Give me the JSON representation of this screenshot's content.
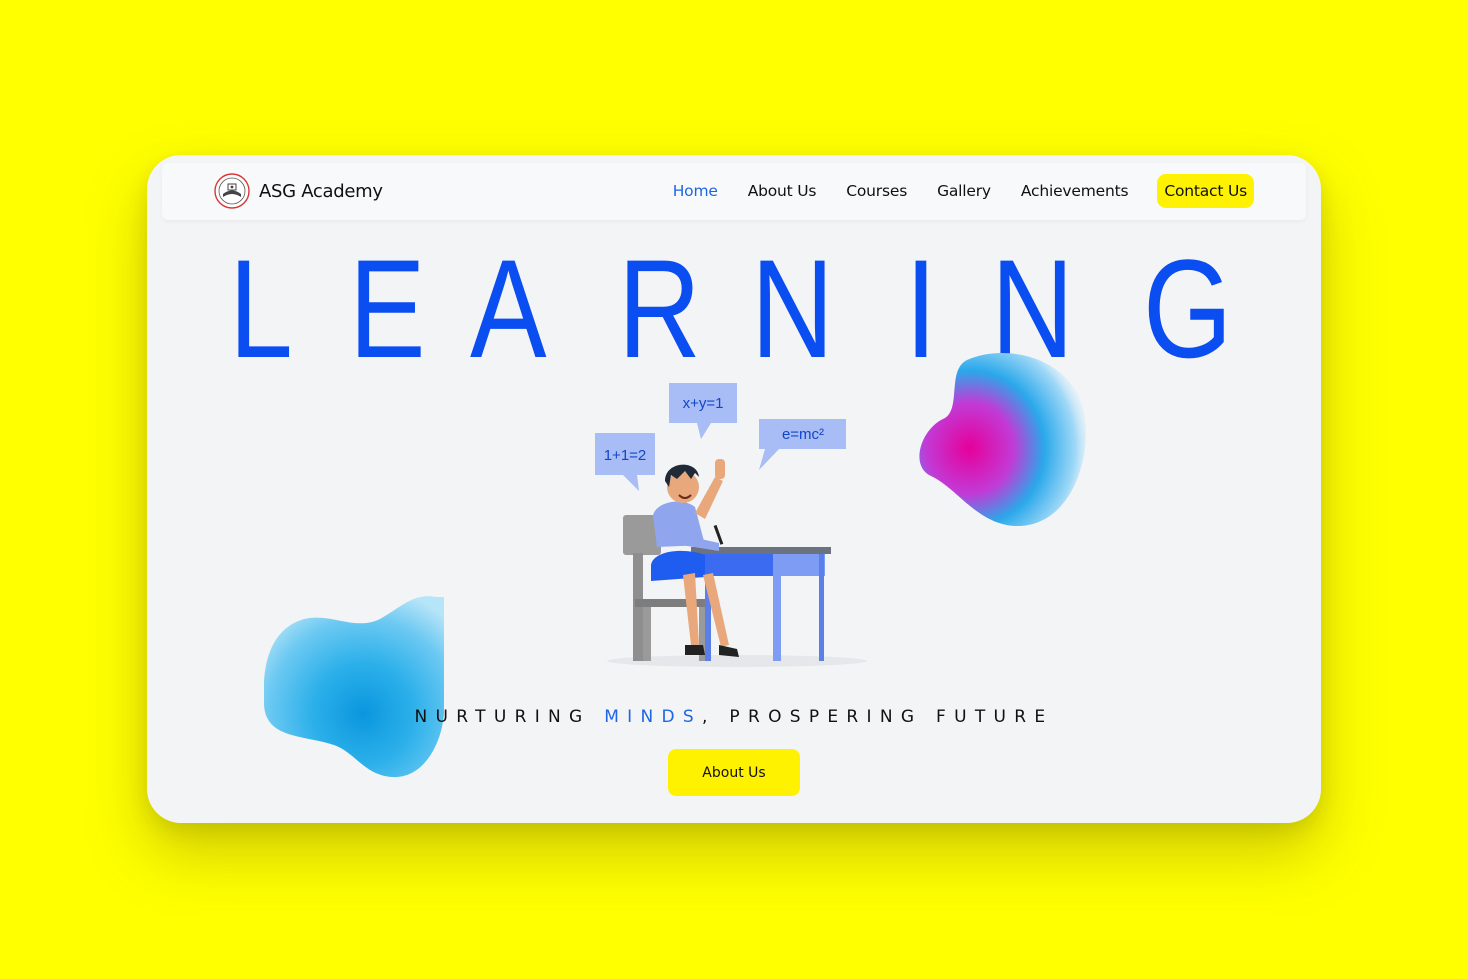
{
  "brand": {
    "name": "ASG Academy",
    "logo_icon": "academy-seal-icon"
  },
  "nav": {
    "items": [
      {
        "label": "Home",
        "active": true
      },
      {
        "label": "About Us",
        "active": false
      },
      {
        "label": "Courses",
        "active": false
      },
      {
        "label": "Gallery",
        "active": false
      },
      {
        "label": "Achievements",
        "active": false
      }
    ],
    "contact_label": "Contact Us"
  },
  "hero": {
    "headline_letters": [
      "L",
      "E",
      "A",
      "R",
      "N",
      "I",
      "N",
      "G"
    ],
    "tagline_pre": "NURTURING ",
    "tagline_accent": "MINDS",
    "tagline_post": ", PROSPERING FUTURE",
    "cta_label": "About Us",
    "bubbles": {
      "left": "1+1=2",
      "top": "x+y=1",
      "right": "e=mc²"
    }
  },
  "colors": {
    "background": "#ffff00",
    "accent_blue": "#1e66e6",
    "headline_blue": "#0a4df0",
    "button_yellow": "#fff200",
    "card": "#f3f4f6"
  }
}
